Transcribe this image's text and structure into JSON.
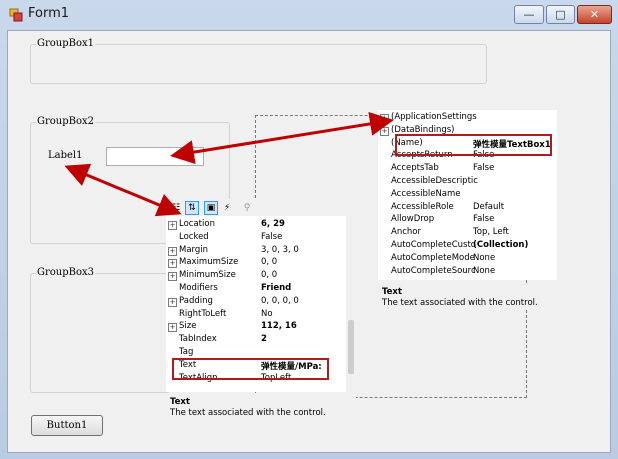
{
  "window": {
    "title": "Form1",
    "controls": {
      "minimize": "—",
      "maximize": "□",
      "close": "✕"
    }
  },
  "form": {
    "groupbox1": "GroupBox1",
    "groupbox2": "GroupBox2",
    "groupbox3": "GroupBox3",
    "label1": "Label1",
    "textbox1_value": "",
    "button1": "Button1"
  },
  "grid_textbox": {
    "rows": [
      {
        "expand": "+",
        "name": "(ApplicationSettings",
        "value": "",
        "bold": false
      },
      {
        "expand": "+",
        "name": "(DataBindings)",
        "value": "",
        "bold": false
      },
      {
        "expand": "",
        "name": "(Name)",
        "value": "弹性模量TextBox1",
        "bold": true
      },
      {
        "expand": "",
        "name": "AcceptsReturn",
        "value": "False",
        "bold": false
      },
      {
        "expand": "",
        "name": "AcceptsTab",
        "value": "False",
        "bold": false
      },
      {
        "expand": "",
        "name": "AccessibleDescriptic",
        "value": "",
        "bold": false
      },
      {
        "expand": "",
        "name": "AccessibleName",
        "value": "",
        "bold": false
      },
      {
        "expand": "",
        "name": "AccessibleRole",
        "value": "Default",
        "bold": false
      },
      {
        "expand": "",
        "name": "AllowDrop",
        "value": "False",
        "bold": false
      },
      {
        "expand": "",
        "name": "Anchor",
        "value": "Top, Left",
        "bold": false
      },
      {
        "expand": "",
        "name": "AutoCompleteCusto",
        "value": "(Collection)",
        "bold": true
      },
      {
        "expand": "",
        "name": "AutoCompleteMode",
        "value": "None",
        "bold": false
      },
      {
        "expand": "",
        "name": "AutoCompleteSourc",
        "value": "None",
        "bold": false
      }
    ],
    "desc_title": "Text",
    "desc_text": "The text associated with the control."
  },
  "grid_label": {
    "toolbar": [
      "categorized-icon",
      "alphabetical-icon",
      "properties-icon",
      "events-icon",
      "property-pages-icon"
    ],
    "rows": [
      {
        "expand": "+",
        "name": "Location",
        "value": "6, 29",
        "bold": true
      },
      {
        "expand": "",
        "name": "Locked",
        "value": "False",
        "bold": false
      },
      {
        "expand": "+",
        "name": "Margin",
        "value": "3, 0, 3, 0",
        "bold": false
      },
      {
        "expand": "+",
        "name": "MaximumSize",
        "value": "0, 0",
        "bold": false
      },
      {
        "expand": "+",
        "name": "MinimumSize",
        "value": "0, 0",
        "bold": false
      },
      {
        "expand": "",
        "name": "Modifiers",
        "value": "Friend",
        "bold": true
      },
      {
        "expand": "+",
        "name": "Padding",
        "value": "0, 0, 0, 0",
        "bold": false
      },
      {
        "expand": "",
        "name": "RightToLeft",
        "value": "No",
        "bold": false
      },
      {
        "expand": "+",
        "name": "Size",
        "value": "112, 16",
        "bold": true
      },
      {
        "expand": "",
        "name": "TabIndex",
        "value": "2",
        "bold": true
      },
      {
        "expand": "",
        "name": "Tag",
        "value": "",
        "bold": false
      },
      {
        "expand": "",
        "name": "Text",
        "value": "弹性模量/MPa:",
        "bold": true
      },
      {
        "expand": "",
        "name": "TextAlign",
        "value": "TopLeft",
        "bold": false
      }
    ],
    "desc_title": "Text",
    "desc_text": "The text associated with the control."
  },
  "colors": {
    "highlight": "#b01c1c",
    "arrow": "#c00000"
  }
}
